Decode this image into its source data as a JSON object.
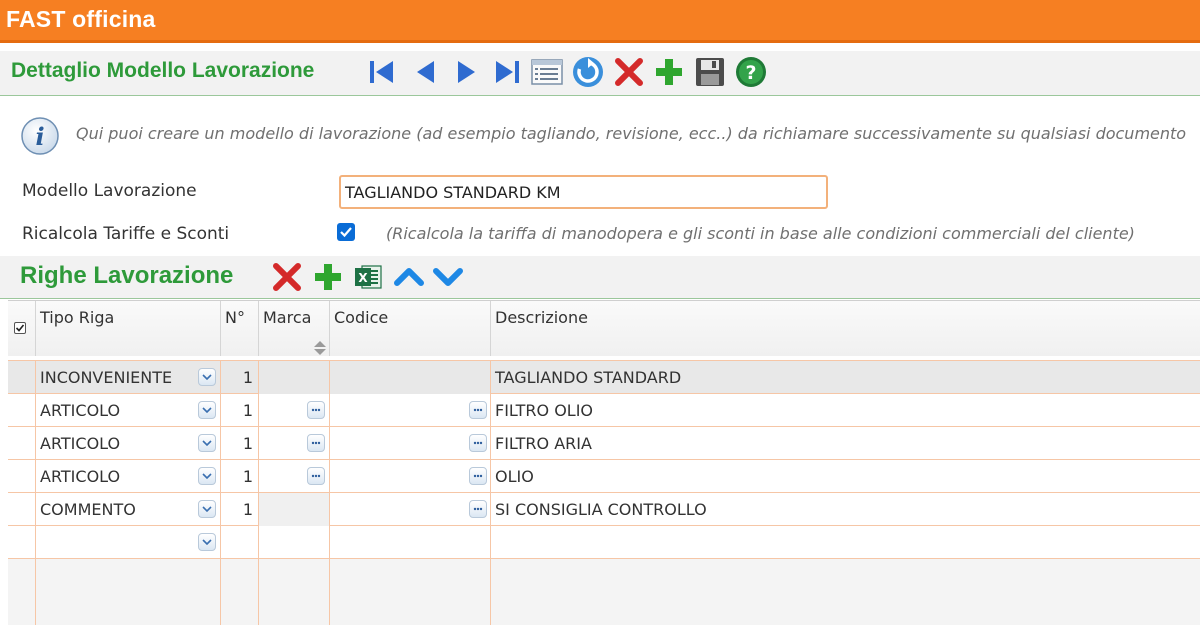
{
  "app": {
    "title": "FAST officina",
    "accent": "#f67f22",
    "section_color": "#2e9a3a"
  },
  "header": {
    "title": "Dettaglio Modello Lavorazione",
    "toolbar_icons": [
      "first-record-icon",
      "previous-record-icon",
      "next-record-icon",
      "last-record-icon",
      "list-icon",
      "refresh-icon",
      "delete-icon",
      "add-icon",
      "save-icon",
      "help-icon"
    ]
  },
  "info": {
    "icon": "info-icon",
    "text": "Qui puoi creare un modello di lavorazione (ad esempio tagliando, revisione, ecc..) da richiamare successivamente su qualsiasi documento"
  },
  "form": {
    "modello_label": "Modello Lavorazione",
    "modello_value": "TAGLIANDO STANDARD KM",
    "ricalcola_label": "Ricalcola Tariffe e Sconti",
    "ricalcola_checked": true,
    "ricalcola_note": "(Ricalcola la tariffa di manodopera e gli sconti in base alle condizioni commerciali del cliente)"
  },
  "righe": {
    "title": "Righe Lavorazione",
    "toolbar_icons": [
      "delete-icon",
      "add-icon",
      "excel-icon",
      "move-up-icon",
      "move-down-icon"
    ],
    "columns": [
      "Tipo Riga",
      "N°",
      "Marca",
      "Codice",
      "Descrizione"
    ],
    "rows": [
      {
        "tipo": "INCONVENIENTE",
        "n": "1",
        "marca": "",
        "codice": "",
        "descrizione": "TAGLIANDO STANDARD"
      },
      {
        "tipo": "ARTICOLO",
        "n": "1",
        "marca": "",
        "codice": "",
        "descrizione": "FILTRO OLIO"
      },
      {
        "tipo": "ARTICOLO",
        "n": "1",
        "marca": "",
        "codice": "",
        "descrizione": "FILTRO ARIA"
      },
      {
        "tipo": "ARTICOLO",
        "n": "1",
        "marca": "",
        "codice": "",
        "descrizione": "OLIO"
      },
      {
        "tipo": "COMMENTO",
        "n": "1",
        "marca": "",
        "codice": "",
        "descrizione": "SI CONSIGLIA CONTROLLO"
      },
      {
        "tipo": "",
        "n": "",
        "marca": "",
        "codice": "",
        "descrizione": ""
      }
    ]
  }
}
